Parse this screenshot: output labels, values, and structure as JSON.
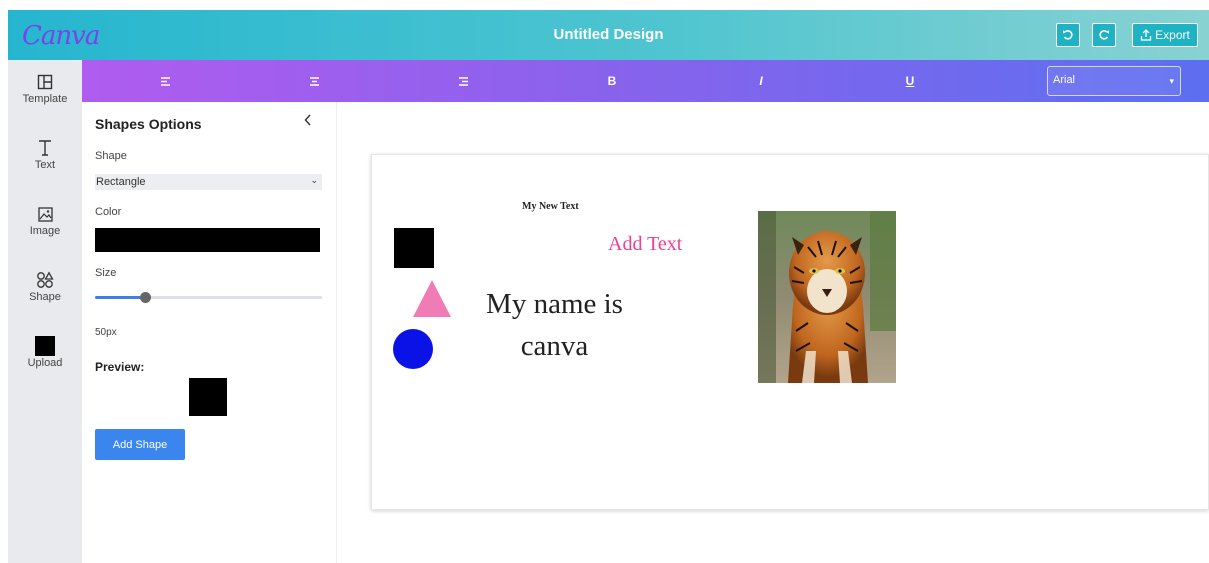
{
  "header": {
    "logo": "Canva",
    "title": "Untitled Design",
    "undo_icon": "undo-icon",
    "redo_icon": "redo-icon",
    "export_label": "Export",
    "colors": {
      "gradient_start": "#25b6cf",
      "gradient_end": "#88d2d2"
    }
  },
  "rail": {
    "items": [
      {
        "label": "Template",
        "icon": "template-icon"
      },
      {
        "label": "Text",
        "icon": "text-icon"
      },
      {
        "label": "Image",
        "icon": "image-icon"
      },
      {
        "label": "Shape",
        "icon": "shape-icon"
      },
      {
        "label": "Upload",
        "icon": "upload-icon"
      }
    ]
  },
  "toolbar": {
    "buttons": [
      {
        "icon": "align-left-icon"
      },
      {
        "icon": "align-center-icon"
      },
      {
        "icon": "align-right-icon"
      },
      {
        "icon": "bold-icon",
        "glyph": "B"
      },
      {
        "icon": "italic-icon",
        "glyph": "I"
      },
      {
        "icon": "underline-icon",
        "glyph": "U"
      }
    ],
    "font": {
      "value": "Arial"
    },
    "colors": {
      "gradient_start": "#b05cf0",
      "gradient_end": "#5c6ff0"
    }
  },
  "panel": {
    "title": "Shapes Options",
    "shape_label": "Shape",
    "shape_value": "Rectangle",
    "color_label": "Color",
    "color_value": "#000000",
    "size_label": "Size",
    "size_value": "50px",
    "size_fraction": 0.22,
    "preview_label": "Preview:",
    "add_button": "Add Shape"
  },
  "canvas": {
    "small_text": "My New Text",
    "add_text": "Add Text",
    "big_text_line1": "My name is",
    "big_text_line2": "canva",
    "colors": {
      "triangle": "#f07cb6",
      "circle": "#0a12e8",
      "add_text": "#ef3e93"
    }
  }
}
